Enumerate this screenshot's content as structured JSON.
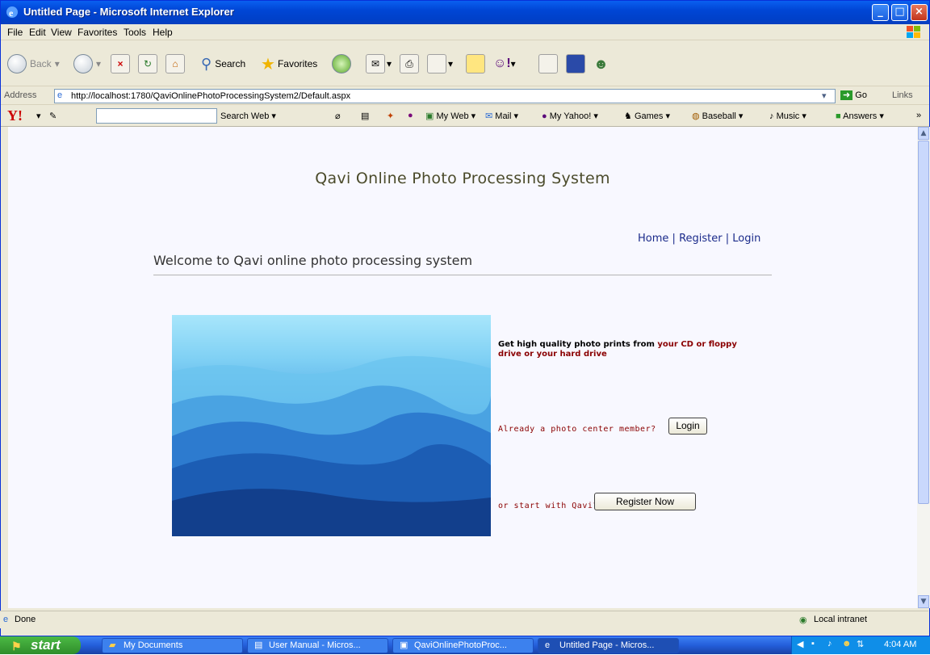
{
  "window": {
    "title": "Untitled Page - Microsoft Internet Explorer"
  },
  "menu": [
    "File",
    "Edit",
    "View",
    "Favorites",
    "Tools",
    "Help"
  ],
  "toolbar": {
    "back": "Back",
    "search": "Search",
    "favorites": "Favorites"
  },
  "address": {
    "label": "Address",
    "url": "http://localhost:1780/QaviOnlinePhotoProcessingSystem2/Default.aspx",
    "go": "Go",
    "links": "Links"
  },
  "yahoo": {
    "search_web": "Search Web",
    "items": [
      "My Web",
      "Mail",
      "My Yahoo!",
      "Games",
      "Baseball",
      "Music",
      "Answers"
    ]
  },
  "page": {
    "site_title": "Qavi Online Photo Processing System",
    "nav": {
      "home": "Home",
      "register": "Register",
      "login": "Login",
      "sep": "|"
    },
    "welcome": "Welcome to Qavi online photo processing system",
    "promo_1": "Get high quality photo prints from ",
    "promo_2": "your CD or floppy drive or your hard drive",
    "member_q": "Already a photo center member?",
    "login_btn": "Login",
    "start_q": "or start with Qavi?",
    "register_btn": "Register Now"
  },
  "status": {
    "text": "Done",
    "zone": "Local intranet"
  },
  "taskbar": {
    "start": "start",
    "tasks": [
      "My Documents",
      "User Manual - Micros...",
      "QaviOnlinePhotoProc...",
      "Untitled Page - Micros..."
    ],
    "clock": "4:04 AM"
  },
  "colors": {
    "title_bar": "#0046d5",
    "accent_red": "#8a0000",
    "nav_link": "#1a2a8a",
    "page_bg": "#f8f8ff"
  }
}
